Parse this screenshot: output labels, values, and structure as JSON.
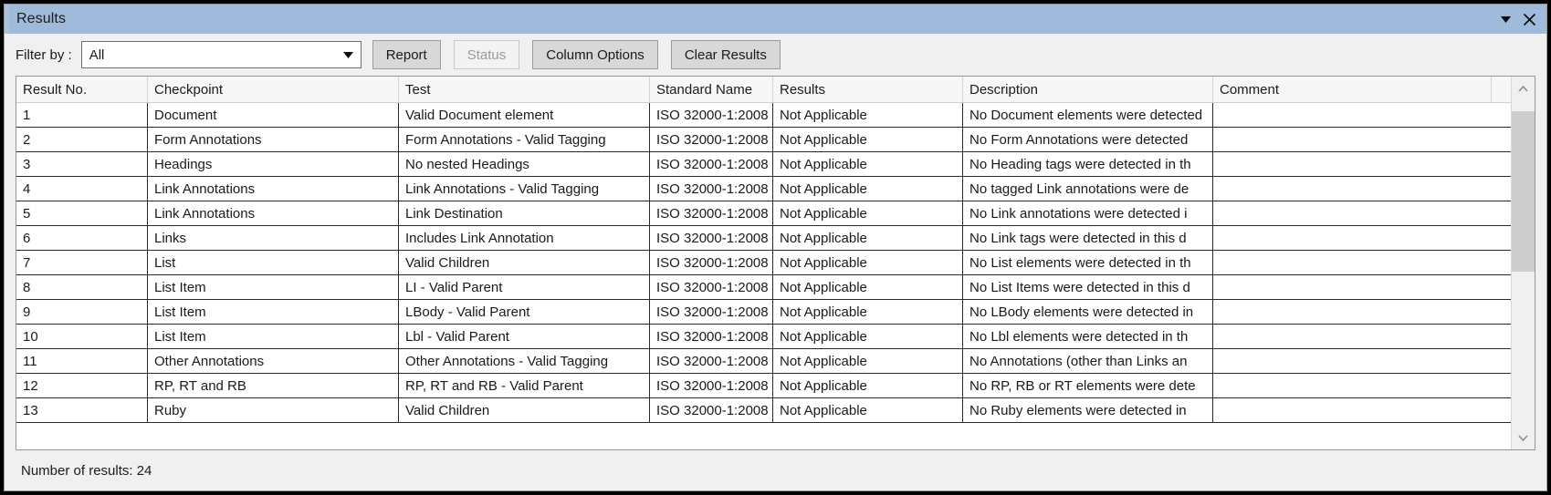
{
  "window": {
    "title": "Results",
    "collapse_icon": "chevron-down-icon",
    "close_icon": "close-icon"
  },
  "toolbar": {
    "filter_label": "Filter by :",
    "filter_value": "All",
    "filter_options": [
      "All"
    ],
    "dropdown_icon": "chevron-down-icon",
    "report_label": "Report",
    "status_label": "Status",
    "status_disabled": true,
    "column_options_label": "Column Options",
    "clear_results_label": "Clear Results"
  },
  "table": {
    "columns": [
      "Result No.",
      "Checkpoint",
      "Test",
      "Standard Name",
      "Results",
      "Description",
      "Comment"
    ],
    "rows": [
      {
        "no": "1",
        "checkpoint": "Document",
        "test": "Valid Document element",
        "standard": "ISO 32000-1:2008",
        "result": "Not Applicable",
        "description": "No Document elements were detected",
        "comment": ""
      },
      {
        "no": "2",
        "checkpoint": "Form Annotations",
        "test": "Form Annotations - Valid Tagging",
        "standard": "ISO 32000-1:2008",
        "result": "Not Applicable",
        "description": "No Form Annotations were detected",
        "comment": ""
      },
      {
        "no": "3",
        "checkpoint": "Headings",
        "test": "No nested Headings",
        "standard": "ISO 32000-1:2008",
        "result": "Not Applicable",
        "description": "No Heading tags were detected in th",
        "comment": ""
      },
      {
        "no": "4",
        "checkpoint": "Link Annotations",
        "test": "Link Annotations - Valid Tagging",
        "standard": "ISO 32000-1:2008",
        "result": "Not Applicable",
        "description": "No tagged Link annotations were de",
        "comment": ""
      },
      {
        "no": "5",
        "checkpoint": "Link Annotations",
        "test": "Link Destination",
        "standard": "ISO 32000-1:2008",
        "result": "Not Applicable",
        "description": "No Link annotations were detected i",
        "comment": ""
      },
      {
        "no": "6",
        "checkpoint": "Links",
        "test": "Includes Link Annotation",
        "standard": "ISO 32000-1:2008",
        "result": "Not Applicable",
        "description": "No Link tags were detected in this d",
        "comment": ""
      },
      {
        "no": "7",
        "checkpoint": "List",
        "test": "Valid Children",
        "standard": "ISO 32000-1:2008",
        "result": "Not Applicable",
        "description": "No List elements were detected in th",
        "comment": ""
      },
      {
        "no": "8",
        "checkpoint": "List Item",
        "test": "LI - Valid Parent",
        "standard": "ISO 32000-1:2008",
        "result": "Not Applicable",
        "description": "No List Items were detected in this d",
        "comment": ""
      },
      {
        "no": "9",
        "checkpoint": "List Item",
        "test": "LBody - Valid Parent",
        "standard": "ISO 32000-1:2008",
        "result": "Not Applicable",
        "description": "No LBody elements were detected in",
        "comment": ""
      },
      {
        "no": "10",
        "checkpoint": "List Item",
        "test": "Lbl - Valid Parent",
        "standard": "ISO 32000-1:2008",
        "result": "Not Applicable",
        "description": "No Lbl elements were detected in th",
        "comment": ""
      },
      {
        "no": "11",
        "checkpoint": "Other Annotations",
        "test": "Other Annotations - Valid Tagging",
        "standard": "ISO 32000-1:2008",
        "result": "Not Applicable",
        "description": "No Annotations (other than Links an",
        "comment": ""
      },
      {
        "no": "12",
        "checkpoint": "RP, RT and RB",
        "test": "RP, RT and RB - Valid Parent",
        "standard": "ISO 32000-1:2008",
        "result": "Not Applicable",
        "description": "No RP, RB or RT elements were dete",
        "comment": ""
      },
      {
        "no": "13",
        "checkpoint": "Ruby",
        "test": "Valid Children",
        "standard": "ISO 32000-1:2008",
        "result": "Not Applicable",
        "description": "No Ruby elements were detected in",
        "comment": ""
      }
    ]
  },
  "scrollbar": {
    "up_icon": "chevron-up-icon",
    "down_icon": "chevron-down-icon"
  },
  "status": {
    "text": "Number of results: 24"
  }
}
